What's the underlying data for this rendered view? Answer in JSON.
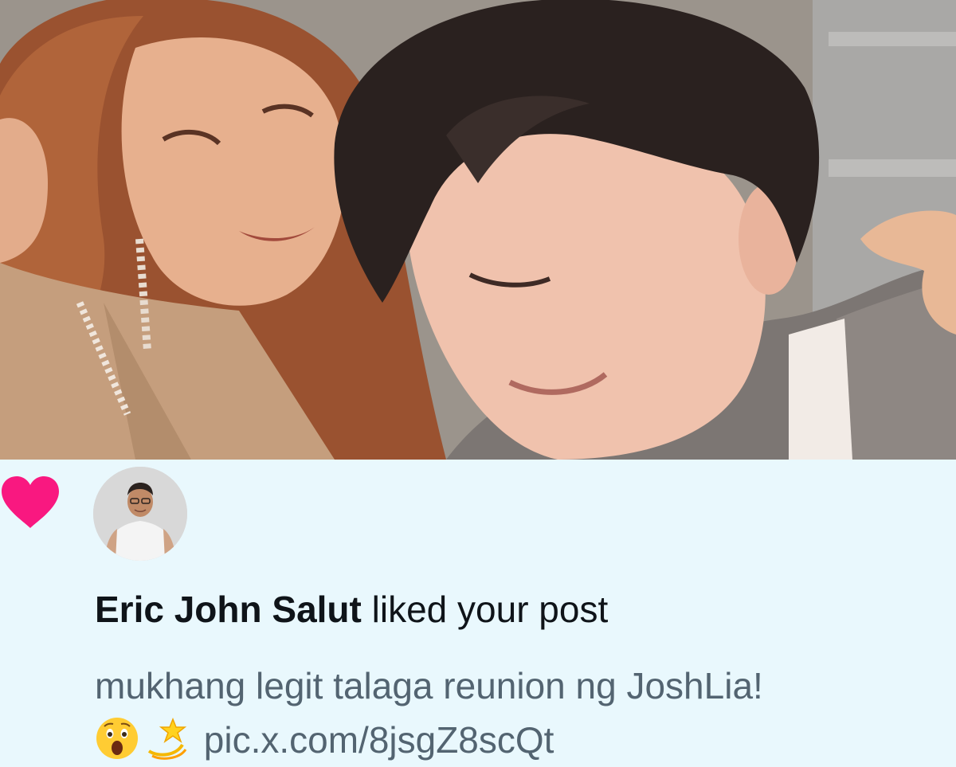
{
  "photo": {
    "description_icon": "photo-image"
  },
  "notification": {
    "icon": "heart-icon",
    "icon_color": "#f91880",
    "user_name": "Eric John Salut",
    "action_text": " liked your post",
    "post_text": "mukhang legit talaga reunion ng JoshLia!",
    "emojis": [
      "astonished-face-icon",
      "dizzy-icon"
    ],
    "link_text": "pic.x.com/8jsgZ8scQt",
    "background_color": "#e9f8fd"
  }
}
